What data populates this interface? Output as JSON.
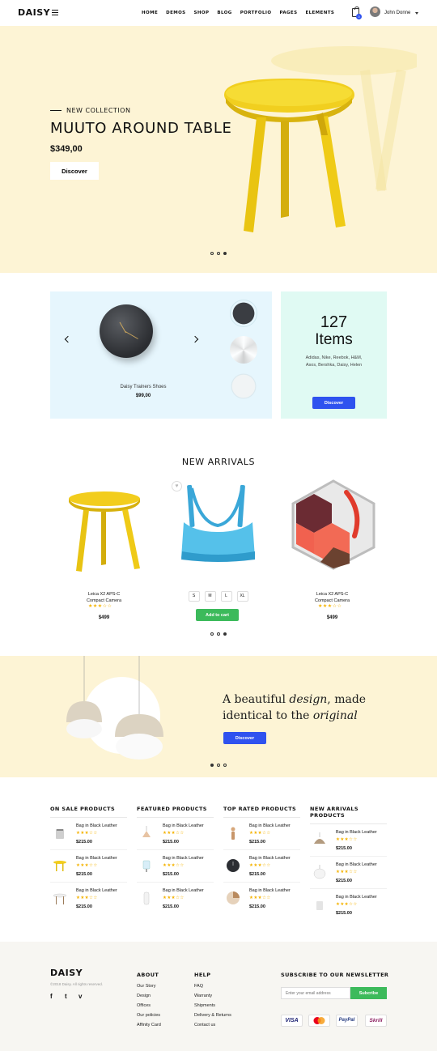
{
  "header": {
    "logo": "DAISY",
    "nav": [
      "HOME",
      "DEMOS",
      "SHOP",
      "BLOG",
      "PORTFOLIO",
      "PAGES",
      "ELEMENTS"
    ],
    "cart_count": "0",
    "user_name": "John Donne"
  },
  "hero": {
    "kicker": "NEW COLLECTION",
    "title": "MUUTO AROUND TABLE",
    "price": "$349,00",
    "button": "Discover",
    "slides": 3,
    "active_slide": 3
  },
  "showcase": {
    "product_name": "Daisy Trainers Shoes",
    "product_price": "$99,00"
  },
  "items_box": {
    "count": "127",
    "label": "Items",
    "brands": "Adidas, Nike, Reebok, H&M, Asos, Bershka, Daisy, Helen",
    "button": "Discover"
  },
  "new_arrivals": {
    "title": "NEW ARRIVALS",
    "products": [
      {
        "name_line1": "Leica X2 APS-C",
        "name_line2": "Compact Camera",
        "rating": 3,
        "price": "$499"
      },
      {
        "sizes": [
          "S",
          "M",
          "L",
          "XL"
        ],
        "button": "Add to cart"
      },
      {
        "name_line1": "Leica X2 APS-C",
        "name_line2": "Compact Camera",
        "rating": 3,
        "price": "$499"
      }
    ],
    "active_slide": 3
  },
  "banner": {
    "line1_prefix": "A beautiful ",
    "line1_em": "design",
    "line1_suffix": ", made",
    "line2_prefix": "identical to the ",
    "line2_em": "original",
    "button": "Discover",
    "active_slide": 1
  },
  "product_lists": [
    {
      "title": "ON SALE PRODUCTS",
      "items": [
        {
          "name": "Bag in Black Leather",
          "rating": 3,
          "price": "$215.00",
          "icon": "candle-thumb"
        },
        {
          "name": "Bag in Black Leather",
          "rating": 3,
          "price": "$215.00",
          "icon": "yellow-table-thumb"
        },
        {
          "name": "Bag in Black Leather",
          "rating": 3,
          "price": "$215.00",
          "icon": "white-table-thumb"
        }
      ]
    },
    {
      "title": "FEATURED PRODUCTS",
      "items": [
        {
          "name": "Bag in Black Leather",
          "rating": 3,
          "price": "$215.00",
          "icon": "lamp-thumb"
        },
        {
          "name": "Bag in Black Leather",
          "rating": 3,
          "price": "$215.00",
          "icon": "glass-lamp-thumb"
        },
        {
          "name": "Bag in Black Leather",
          "rating": 3,
          "price": "$215.00",
          "icon": "vase-thumb"
        }
      ]
    },
    {
      "title": "TOP RATED PRODUCTS",
      "items": [
        {
          "name": "Bag in Black Leather",
          "rating": 3,
          "price": "$215.00",
          "icon": "wood-figure-thumb"
        },
        {
          "name": "Bag in Black Leather",
          "rating": 3,
          "price": "$215.00",
          "icon": "clock-thumb"
        },
        {
          "name": "Bag in Black Leather",
          "rating": 3,
          "price": "$215.00",
          "icon": "wood-clock-thumb"
        }
      ]
    },
    {
      "title": "NEW ARRIVALS PRODUCTS",
      "items": [
        {
          "name": "Bag in Black Leather",
          "rating": 3,
          "price": "$215.00",
          "icon": "pendant-thumb"
        },
        {
          "name": "Bag in Black Leather",
          "rating": 3,
          "price": "$215.00",
          "icon": "white-pendant-thumb"
        },
        {
          "name": "Bag in Black Leather",
          "rating": 3,
          "price": "$215.00",
          "icon": "cup-thumb"
        }
      ]
    }
  ],
  "footer": {
    "logo": "DAISY",
    "copyright": "©2018 Daisy. All rights reserved.",
    "social": [
      "f",
      "t",
      "v"
    ],
    "about_title": "ABOUT",
    "about_links": [
      "Our Story",
      "Design",
      "Offices",
      "Our policies",
      "Affinity Card"
    ],
    "help_title": "HELP",
    "help_links": [
      "FAQ",
      "Warranty",
      "Shipments",
      "Delivery & Returns",
      "Contact us"
    ],
    "newsletter_title": "SUBSCRIBE TO OUR NEWSLETTER",
    "newsletter_placeholder": "Enter your email address",
    "newsletter_button": "Subcribe",
    "payments": [
      "VISA",
      "mastercard",
      "PayPal",
      "Skrill"
    ]
  },
  "colors": {
    "accent_blue": "#2f52ef",
    "accent_green": "#3cba5b",
    "cream": "#fdf4d5",
    "star": "#f5b301"
  }
}
